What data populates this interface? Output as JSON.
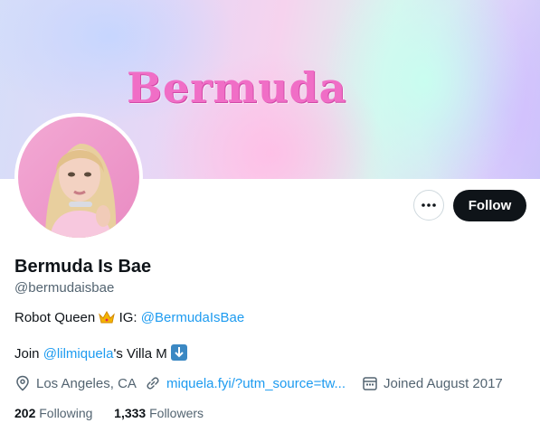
{
  "banner": {
    "logo_text": "Bermuda"
  },
  "actions": {
    "follow_label": "Follow",
    "more_icon": "more-horizontal-icon"
  },
  "profile": {
    "name": "Bermuda Is Bae",
    "handle": "@bermudaisbae",
    "bio": {
      "line1_prefix": "Robot Queen ",
      "line1_emoji": "crown-icon",
      "line1_middle": " IG: ",
      "line1_link": "@BermudaIsBae",
      "line2_prefix": "Join ",
      "line2_link": "@lilmiquela",
      "line2_suffix": "'s Villa M ",
      "line2_emoji": "down-arrow-icon"
    },
    "location": "Los Angeles, CA",
    "website": "miquela.fyi/?utm_source=tw...",
    "joined": "Joined August 2017",
    "following_count": "202",
    "following_label": " Following",
    "followers_count": "1,333",
    "followers_label": " Followers"
  },
  "colors": {
    "accent": "#1d9bf0",
    "text": "#0f1419",
    "muted": "#536471",
    "follow_bg": "#0f1419"
  }
}
